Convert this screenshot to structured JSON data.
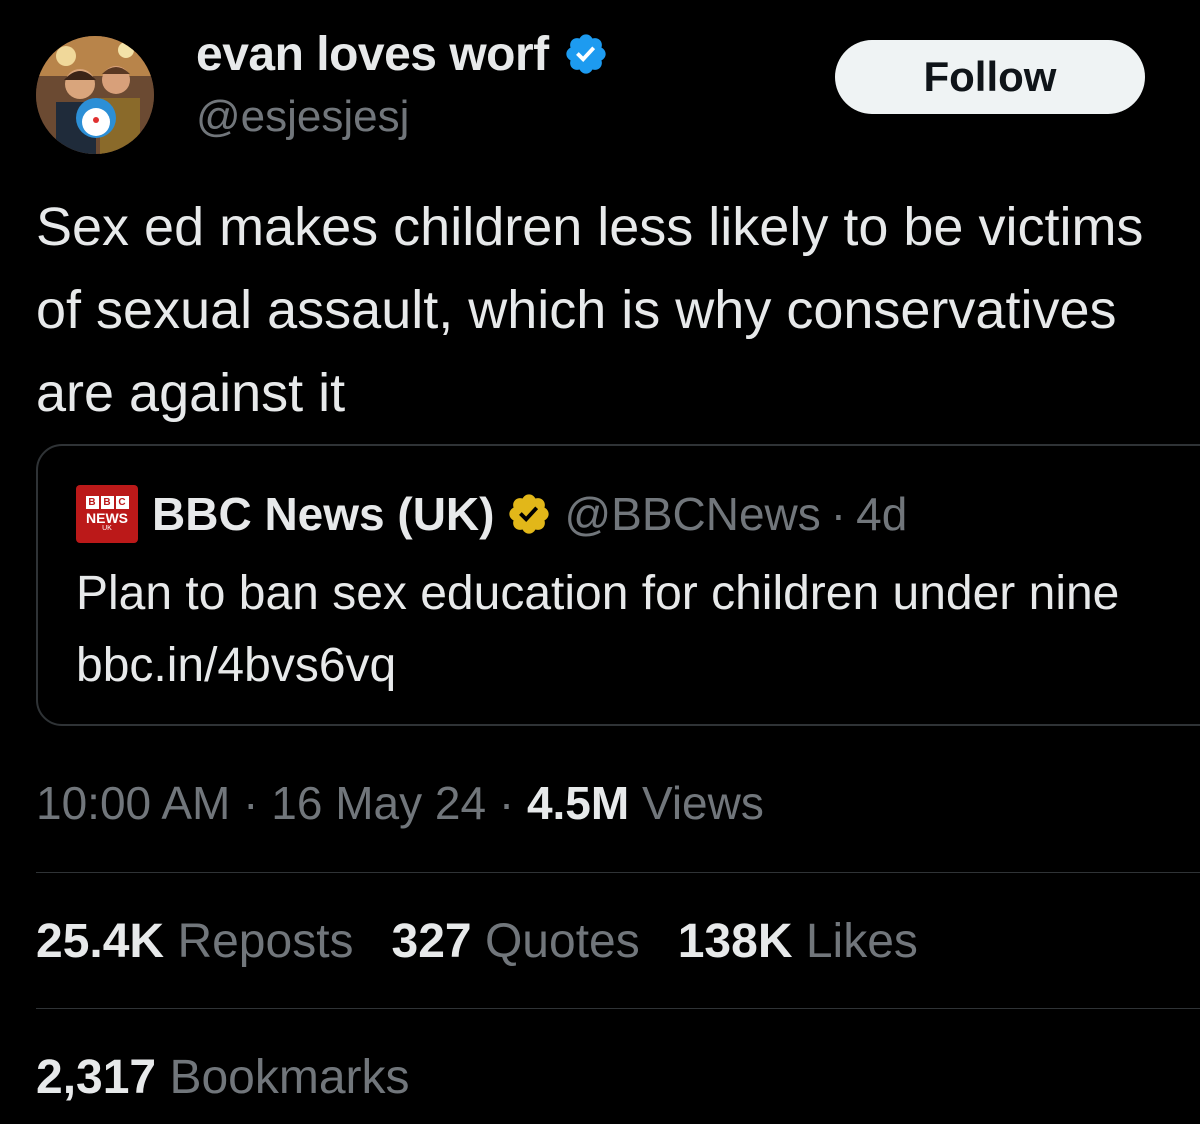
{
  "author": {
    "display_name": "evan loves worf",
    "handle": "@esjesjesj",
    "verified_color": "#1d9bf0"
  },
  "follow_label": "Follow",
  "tweet_text": "Sex ed makes children less likely to be victims of sexual assault, which is why conservatives are against it",
  "quote": {
    "logo_letters": [
      "B",
      "B",
      "C"
    ],
    "logo_text": "NEWS",
    "logo_subtext": "UK",
    "name": "BBC News (UK)",
    "handle": "@BBCNews",
    "separator": "·",
    "age": "4d",
    "text": "Plan to ban sex education for children under nine bbc.in/4bvs6vq",
    "verified_color": "#e2b719",
    "brand_color": "#bb1919"
  },
  "meta": {
    "time": "10:00 AM",
    "date": "16 May 24",
    "views_count": "4.5M",
    "views_label": "Views"
  },
  "stats": {
    "reposts_count": "25.4K",
    "reposts_label": "Reposts",
    "quotes_count": "327",
    "quotes_label": "Quotes",
    "likes_count": "138K",
    "likes_label": "Likes",
    "bookmarks_count": "2,317",
    "bookmarks_label": "Bookmarks"
  }
}
